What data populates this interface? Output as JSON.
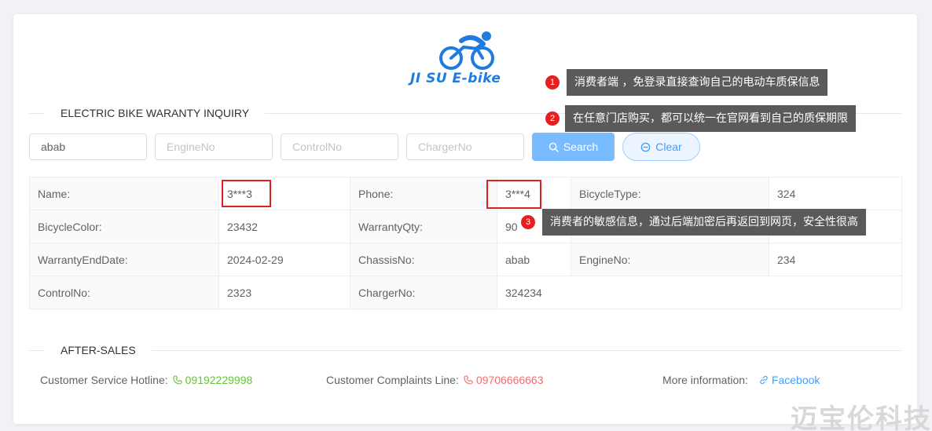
{
  "logo": {
    "text": "JI SU E-bike"
  },
  "sections": {
    "inquiry_title": "ELECTRIC BIKE WARANTY INQUIRY",
    "aftersales_title": "AFTER-SALES"
  },
  "search": {
    "chassis_value": "abab",
    "engine_placeholder": "EngineNo",
    "control_placeholder": "ControlNo",
    "charger_placeholder": "ChargerNo",
    "search_label": "Search",
    "clear_label": "Clear"
  },
  "details": {
    "name_label": "Name:",
    "name_value": "3***3",
    "phone_label": "Phone:",
    "phone_value": "3***4",
    "bicycle_type_label": "BicycleType:",
    "bicycle_type_value": "324",
    "bicycle_color_label": "BicycleColor:",
    "bicycle_color_value": "23432",
    "warranty_qty_label": "WarrantyQty:",
    "warranty_qty_value": "90",
    "warranty_end_label": "WarrantyEndDate:",
    "warranty_end_value": "2024-02-29",
    "chassis_label": "ChassisNo:",
    "chassis_value": "abab",
    "engine_label": "EngineNo:",
    "engine_value": "234",
    "control_label": "ControlNo:",
    "control_value": "2323",
    "charger_label": "ChargerNo:",
    "charger_value": "324234"
  },
  "aftersales": {
    "hotline_label": "Customer Service Hotline:",
    "hotline_number": "09192229998",
    "complaints_label": "Customer Complaints Line:",
    "complaints_number": "09706666663",
    "more_label": "More information:",
    "facebook_label": "Facebook"
  },
  "annotations": [
    {
      "number": "1",
      "text": "消费者端 ，免登录直接查询自己的电动车质保信息"
    },
    {
      "number": "2",
      "text": "在任意门店购买，都可以统一在官网看到自己的质保期限"
    },
    {
      "number": "3",
      "text": "消费者的敏感信息，通过后端加密后再返回到网页，安全性很高"
    }
  ],
  "watermark": "迈宝伦科技",
  "colors": {
    "primary": "#409eff",
    "search_button": "#79bbff",
    "hotline": "#67c23a",
    "complaints": "#f56c6c",
    "highlight_box": "#e02020",
    "callout_bg": "#5a5a5a",
    "logo_blue": "#1f7be0"
  },
  "icons": {
    "search": "search-icon",
    "clear": "clear-icon",
    "phone": "phone-icon",
    "link": "link-icon",
    "logo": "cyclist-logo-icon"
  }
}
